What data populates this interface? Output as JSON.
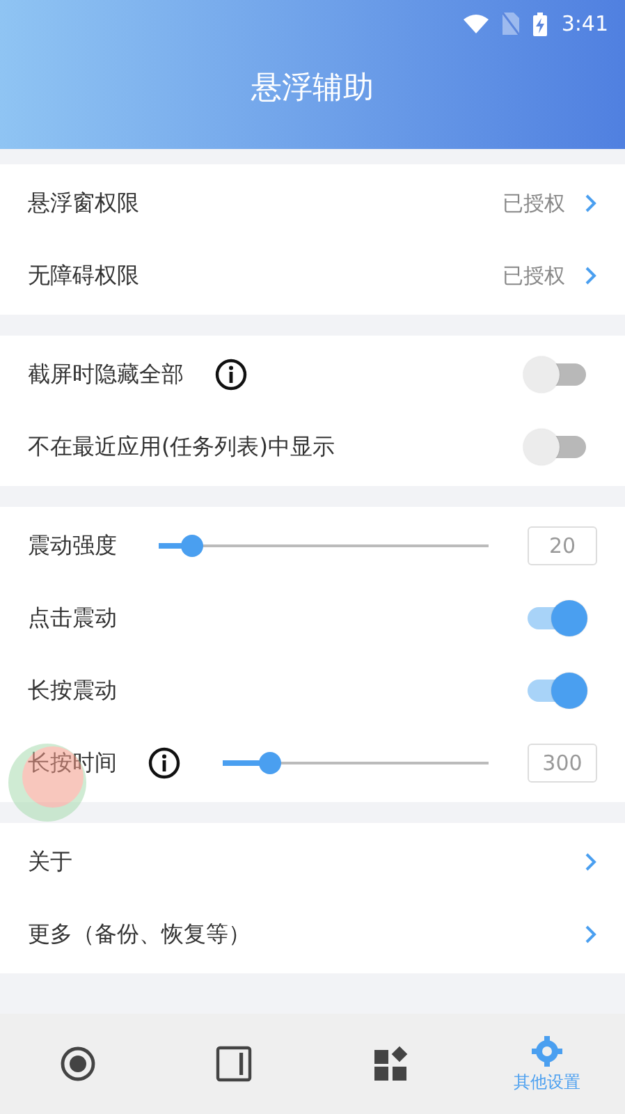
{
  "status_bar": {
    "time": "3:41"
  },
  "header": {
    "title": "悬浮辅助"
  },
  "sections": [
    {
      "rows": [
        {
          "kind": "link",
          "label": "悬浮窗权限",
          "value": "已授权"
        },
        {
          "kind": "link",
          "label": "无障碍权限",
          "value": "已授权"
        }
      ]
    },
    {
      "rows": [
        {
          "kind": "switch",
          "label": "截屏时隐藏全部",
          "info": true,
          "on": false
        },
        {
          "kind": "switch",
          "label": "不在最近应用(任务列表)中显示",
          "info": false,
          "on": false
        }
      ]
    },
    {
      "rows": [
        {
          "kind": "slider",
          "label": "震动强度",
          "info": false,
          "level": 0.1,
          "reading": "20"
        },
        {
          "kind": "switch",
          "label": "点击震动",
          "info": false,
          "on": true
        },
        {
          "kind": "switch",
          "label": "长按震动",
          "info": false,
          "on": true
        },
        {
          "kind": "slider",
          "label": "长按时间",
          "info": true,
          "level": 0.18,
          "reading": "300"
        }
      ]
    },
    {
      "rows": [
        {
          "kind": "link",
          "label": "关于"
        },
        {
          "kind": "link",
          "label": "更多（备份、恢复等）"
        }
      ]
    }
  ],
  "bottom_nav": [
    {
      "selected": false
    },
    {
      "selected": false
    },
    {
      "selected": false
    },
    {
      "label": "其他设置",
      "selected": true
    }
  ]
}
